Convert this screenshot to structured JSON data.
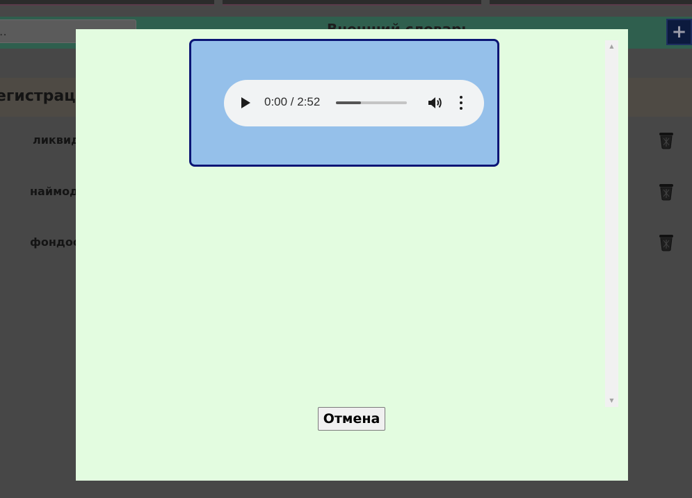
{
  "background": {
    "search_text": "..",
    "header_title": "Внешний словарь",
    "plus_label": "+",
    "section_label": "егистраци",
    "rows": [
      {
        "label": "ликвид"
      },
      {
        "label": "наймод"
      },
      {
        "label": "фондоо"
      }
    ]
  },
  "modal": {
    "audio": {
      "time": "0:00 / 2:52",
      "progress": 0.35
    },
    "cancel_label": "Отмена"
  },
  "colors": {
    "modal_bg": "#e3fce0",
    "card_bg": "#95c0ea",
    "card_border": "#0b1575"
  }
}
